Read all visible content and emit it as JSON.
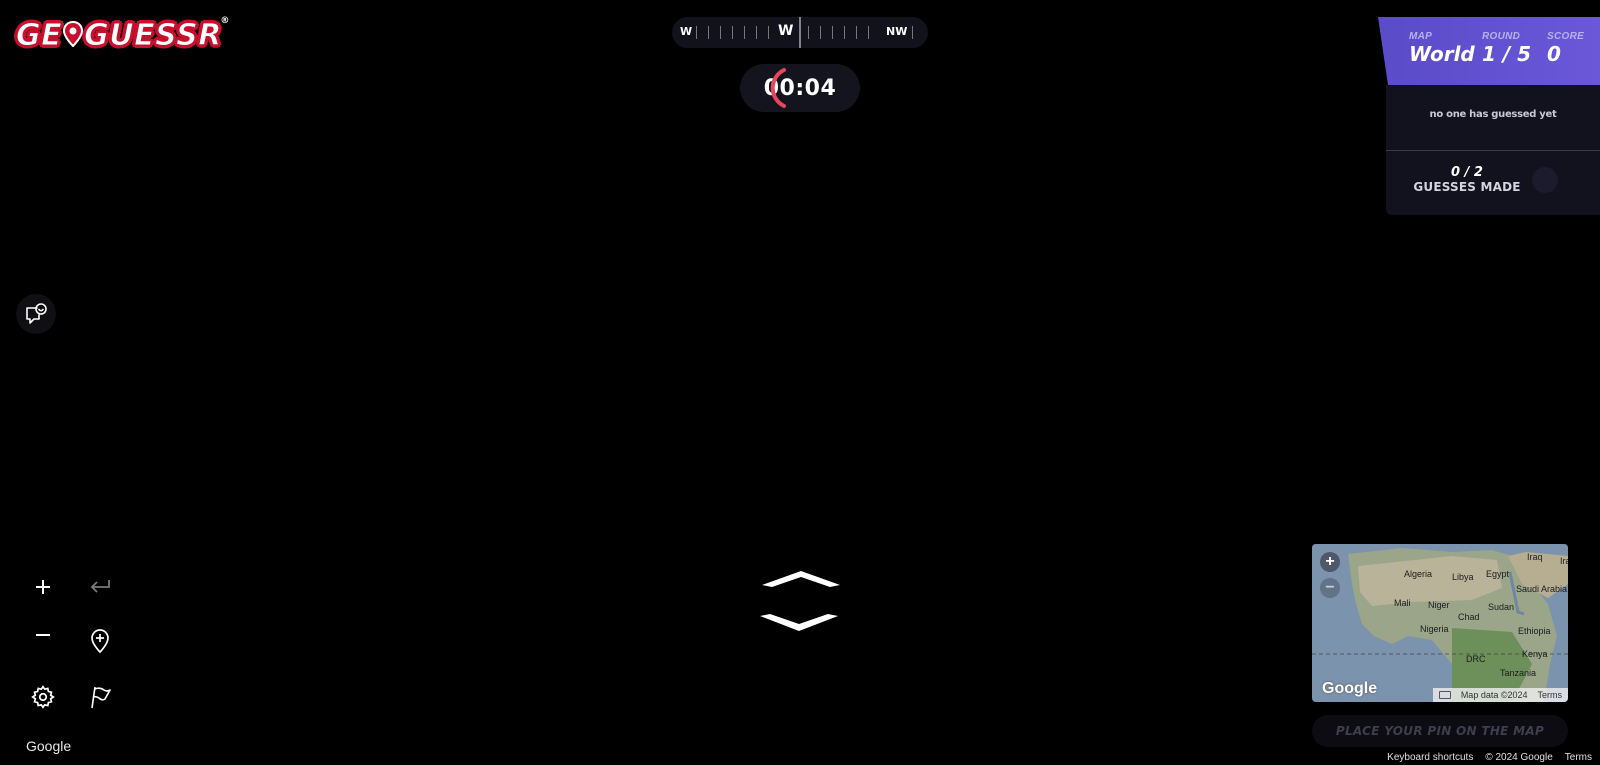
{
  "logo": {
    "text_pre": "GE",
    "text_post": "GUESSR",
    "registered": "®"
  },
  "compass": {
    "left_label": "W",
    "center_label": "W",
    "right_label": "NW"
  },
  "timer": {
    "value": "00:04",
    "color": "#e8465b"
  },
  "status": {
    "map_label": "MAP",
    "map_value": "World",
    "round_label": "ROUND",
    "round_value": "1 / 5",
    "score_label": "SCORE",
    "score_value": "0",
    "accent": "#5a4bc9"
  },
  "guesses": {
    "note": "no one has guessed yet",
    "count": "0 / 2",
    "label": "GUESSES MADE"
  },
  "controls": {
    "zoom_in_icon": "plus-icon",
    "undo_icon": "undo-arrow-icon",
    "zoom_out_icon": "minus-icon",
    "return_to_start_icon": "pin-plus-icon",
    "settings_icon": "gear-icon",
    "flag_icon": "flag-icon",
    "chat_icon": "chat-icon"
  },
  "google_watermark": "Google",
  "minimap": {
    "countries": [
      "Algeria",
      "Libya",
      "Egypt",
      "Iraq",
      "Ira",
      "Saudi Arabia",
      "Mali",
      "Niger",
      "Chad",
      "Sudan",
      "Nigeria",
      "Ethiopia",
      "Kenya",
      "DRC",
      "Tanzania"
    ],
    "google_logo": "Google",
    "footer_map_data": "Map data ©2024",
    "footer_terms": "Terms"
  },
  "place_pin_label": "PLACE YOUR PIN ON THE MAP",
  "footer": {
    "shortcuts": "Keyboard shortcuts",
    "copyright": "© 2024 Google",
    "terms": "Terms"
  }
}
